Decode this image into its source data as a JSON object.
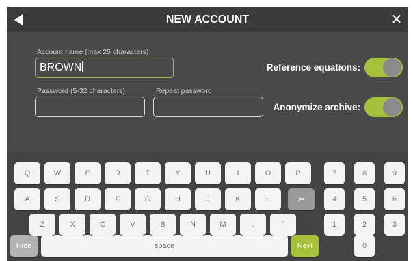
{
  "header": {
    "title": "NEW ACCOUNT",
    "back_icon": "back-arrow-icon",
    "close_glyph": "✕"
  },
  "form": {
    "account_name": {
      "label": "Account name (max 25 characters)",
      "value": "BROWN"
    },
    "password": {
      "label": "Password (5-32 characters)",
      "value": ""
    },
    "repeat_password": {
      "label": "Repeat password",
      "value": ""
    }
  },
  "options": {
    "reference_equations": {
      "label": "Reference equations:",
      "on": true
    },
    "anonymize_archive": {
      "label": "Anonymize archive:",
      "on": true
    }
  },
  "keyboard": {
    "row1": [
      "Q",
      "W",
      "E",
      "R",
      "T",
      "Y",
      "U",
      "I",
      "O",
      "P"
    ],
    "row2": [
      "A",
      "S",
      "D",
      "F",
      "G",
      "H",
      "J",
      "K",
      "L"
    ],
    "backspace": "⇦",
    "row3": [
      "Z",
      "X",
      "C",
      "V",
      "B",
      "N",
      "M",
      ".",
      "`"
    ],
    "hide": "Hide",
    "space": "space",
    "next": "Next",
    "numpad": [
      "7",
      "8",
      "9",
      "4",
      "5",
      "6",
      "1",
      "2",
      "3",
      "0"
    ]
  },
  "colors": {
    "accent": "#a6c03a",
    "background": "#494949",
    "header": "#3b3b3b"
  }
}
